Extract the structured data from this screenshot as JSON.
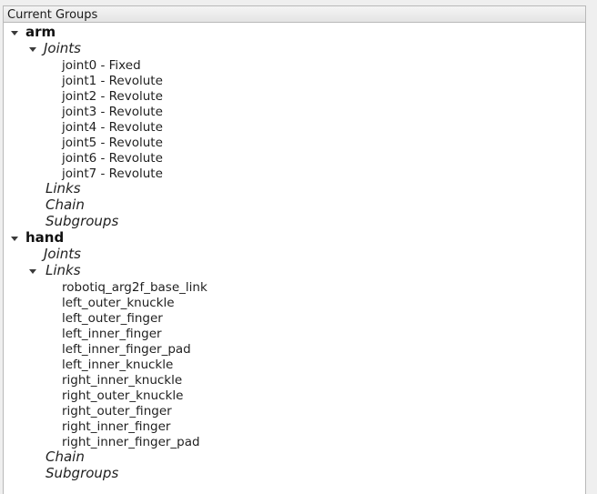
{
  "header": {
    "title": "Current Groups"
  },
  "groups": [
    {
      "name": "arm",
      "joints_label": "Joints",
      "joints": [
        "joint0 - Fixed",
        "joint1 - Revolute",
        "joint2 - Revolute",
        "joint3 - Revolute",
        "joint4 - Revolute",
        "joint5 - Revolute",
        "joint6 - Revolute",
        "joint7 - Revolute"
      ],
      "links_label": "Links",
      "chain_label": "Chain",
      "subgroups_label": "Subgroups"
    },
    {
      "name": "hand",
      "joints_label": "Joints",
      "links_label": "Links",
      "links": [
        "robotiq_arg2f_base_link",
        "left_outer_knuckle",
        "left_outer_finger",
        "left_inner_finger",
        "left_inner_finger_pad",
        "left_inner_knuckle",
        "right_inner_knuckle",
        "right_outer_knuckle",
        "right_outer_finger",
        "right_inner_finger",
        "right_inner_finger_pad"
      ],
      "chain_label": "Chain",
      "subgroups_label": "Subgroups"
    }
  ]
}
